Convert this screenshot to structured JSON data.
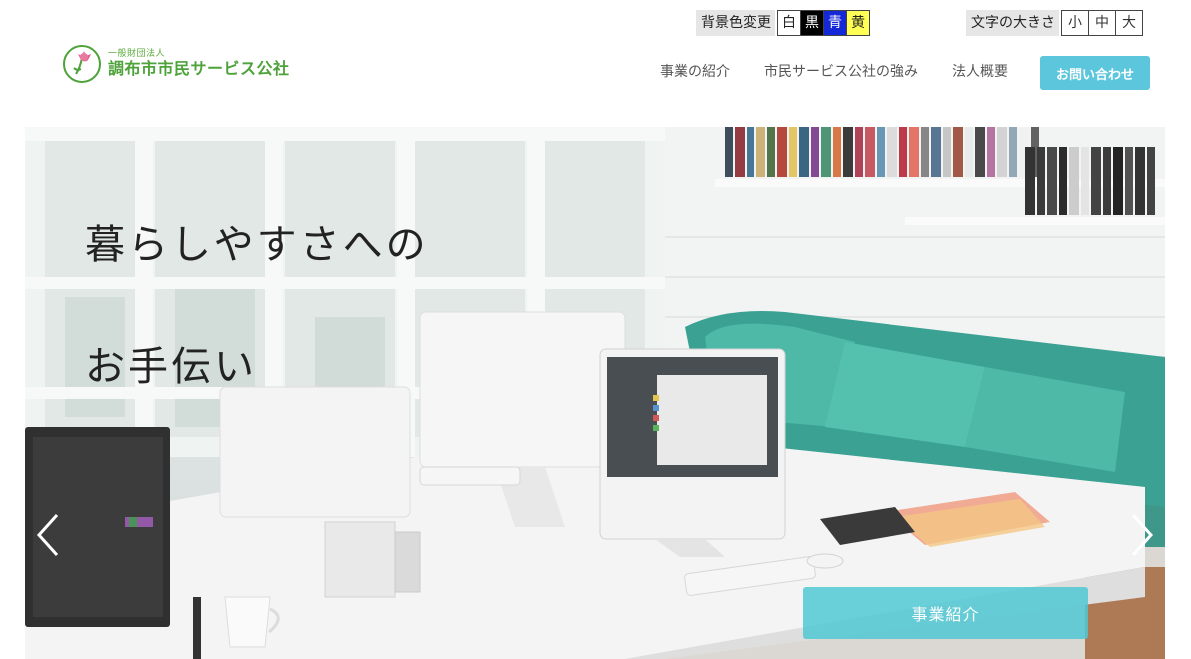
{
  "utility": {
    "bg_label": "背景色変更",
    "bg_options": [
      {
        "label": "白",
        "bg": "#ffffff",
        "fg": "#222222"
      },
      {
        "label": "黒",
        "bg": "#000000",
        "fg": "#ffffff"
      },
      {
        "label": "青",
        "bg": "#1428d8",
        "fg": "#ffffff"
      },
      {
        "label": "黄",
        "bg": "#ffff55",
        "fg": "#222222"
      }
    ],
    "size_label": "文字の大きさ",
    "size_options": [
      "小",
      "中",
      "大"
    ]
  },
  "logo": {
    "small": "一般財団法人",
    "name": "調布市市民サービス公社"
  },
  "nav": {
    "items": [
      "事業の紹介",
      "市民サービス公社の強み",
      "法人概要"
    ],
    "contact": "お問い合わせ"
  },
  "hero": {
    "title_line1": "暮らしやすさへの",
    "title_line2": "お手伝い",
    "button": "事業紹介"
  },
  "colors": {
    "accent": "#5bc6dc",
    "logo_green": "#4ea23a",
    "logo_pink": "#e05a8a"
  }
}
